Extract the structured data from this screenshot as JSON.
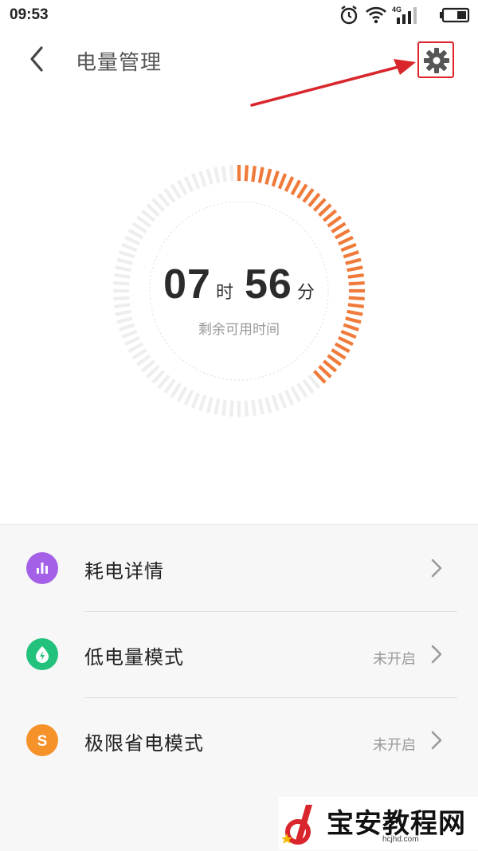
{
  "status_bar": {
    "time": "09:53",
    "network": "4G"
  },
  "header": {
    "title": "电量管理"
  },
  "battery": {
    "hours": "07",
    "hours_unit": "时",
    "minutes": "56",
    "minutes_unit": "分",
    "caption": "剩余可用时间",
    "level_fraction": 0.39
  },
  "menu": {
    "items": [
      {
        "label": "耗电详情",
        "state": "",
        "icon": "bar-chart-icon",
        "color": "#a461e8"
      },
      {
        "label": "低电量模式",
        "state": "未开启",
        "icon": "leaf-bolt-icon",
        "color": "#22c17c"
      },
      {
        "label": "极限省电模式",
        "state": "未开启",
        "icon": "s-letter-icon",
        "icon_text": "S",
        "color": "#f5922a"
      }
    ]
  },
  "colors": {
    "accent": "#f07a3a",
    "track": "#eeeeee",
    "highlight": "#e0242c"
  },
  "watermark": {
    "text": "宝安教程网",
    "sub": "hcjhd.com"
  }
}
